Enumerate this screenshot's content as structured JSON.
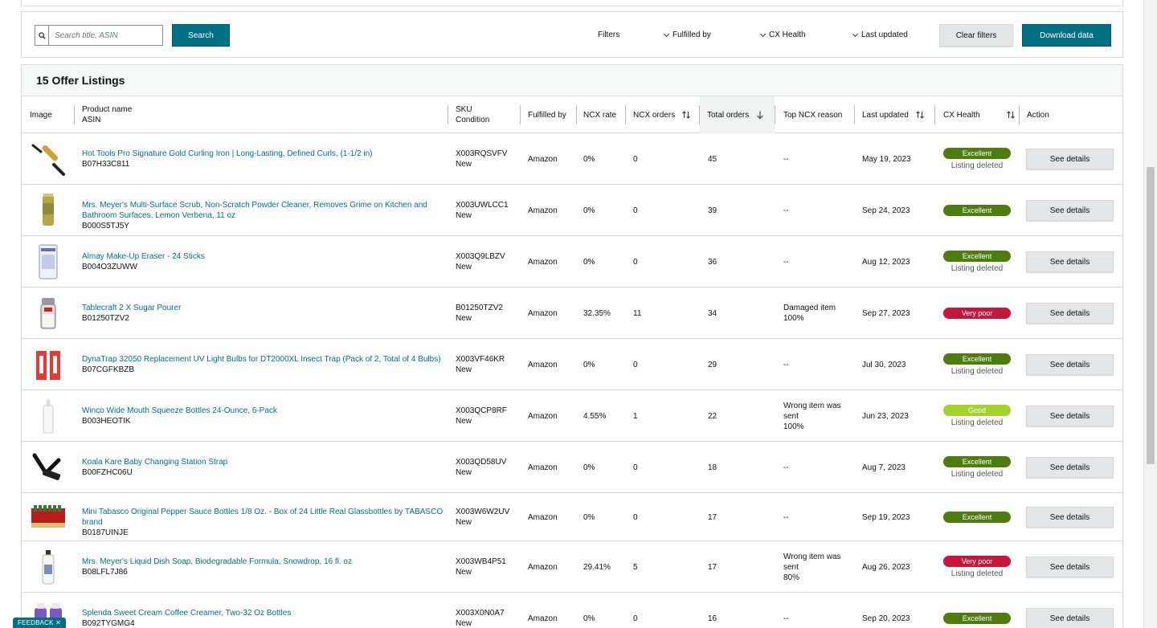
{
  "filters": {
    "search_placeholder": "Search title, ASIN",
    "search_label": "Search",
    "filters_label": "Filters",
    "fulfilled_by_label": "Fulfilled by",
    "cx_health_label": "CX Health",
    "last_updated_label": "Last updated",
    "clear_label": "Clear filters",
    "download_label": "Download data"
  },
  "listings": {
    "title": "15 Offer Listings",
    "columns": {
      "image": "Image",
      "product_name": "Product name",
      "asin": "ASIN",
      "sku": "SKU",
      "condition": "Condition",
      "fulfilled_by": "Fulfilled by",
      "ncx_rate": "NCX rate",
      "ncx_orders": "NCX orders",
      "total_orders": "Total orders",
      "top_ncx_reason": "Top NCX reason",
      "last_updated": "Last updated",
      "cx_health": "CX Health",
      "action": "Action"
    },
    "sorted_column": "total_orders",
    "rows": [
      {
        "name": "Hot Tools Pro Signature Gold Curling Iron | Long-Lasting, Defined Curls, (1-1/2 in)",
        "asin": "B07H33C811",
        "sku": "X003RQSVFV",
        "condition": "New",
        "fulfilled_by": "Amazon",
        "ncx_rate": "0%",
        "ncx_orders": "0",
        "total_orders": "45",
        "reason_1": "--",
        "reason_2": "",
        "reason_3": "",
        "last_updated": "May 19, 2023",
        "health": "Excellent",
        "health_color": "#4d7c0f",
        "note": "Listing deleted",
        "action": "See details",
        "thumb": "curling-iron-image"
      },
      {
        "name": "Mrs. Meyer's Multi-Surface Scrub, Non-Scratch Powder Cleaner, Removes Grime on Kitchen and Bathroom Surfaces, Lemon Verbena, 11 oz",
        "asin": "B000S5TJ5Y",
        "sku": "X003UWLCC1",
        "condition": "New",
        "fulfilled_by": "Amazon",
        "ncx_rate": "0%",
        "ncx_orders": "0",
        "total_orders": "39",
        "reason_1": "--",
        "reason_2": "",
        "reason_3": "",
        "last_updated": "Sep 24, 2023",
        "health": "Excellent",
        "health_color": "#4d7c0f",
        "note": "",
        "action": "See details",
        "thumb": "scrub-canister-image"
      },
      {
        "name": "Almay Make-Up Eraser - 24 Sticks",
        "asin": "B004O3ZUWW",
        "sku": "X003Q9LBZV",
        "condition": "New",
        "fulfilled_by": "Amazon",
        "ncx_rate": "0%",
        "ncx_orders": "0",
        "total_orders": "36",
        "reason_1": "--",
        "reason_2": "",
        "reason_3": "",
        "last_updated": "Aug 12, 2023",
        "health": "Excellent",
        "health_color": "#4d7c0f",
        "note": "Listing deleted",
        "action": "See details",
        "thumb": "makeup-eraser-image"
      },
      {
        "name": "Tablecraft 2 X Sugar Pourer",
        "asin": "B01250TZV2",
        "sku": "B01250TZV2",
        "condition": "New",
        "fulfilled_by": "Amazon",
        "ncx_rate": "32.35%",
        "ncx_orders": "11",
        "total_orders": "34",
        "reason_1": "Damaged item",
        "reason_2": "100%",
        "reason_3": "",
        "last_updated": "Sep 27, 2023",
        "health": "Very poor",
        "health_color": "#c7163c",
        "note": "",
        "action": "See details",
        "thumb": "sugar-pourer-image"
      },
      {
        "name": "DynaTrap 32050 Replacement UV Light Bulbs for DT2000XL Insect Trap (Pack of 2, Total of 4 Bulbs)",
        "asin": "B07CGFKBZB",
        "sku": "X003VF46KR",
        "condition": "New",
        "fulfilled_by": "Amazon",
        "ncx_rate": "0%",
        "ncx_orders": "0",
        "total_orders": "29",
        "reason_1": "--",
        "reason_2": "",
        "reason_3": "",
        "last_updated": "Jul 30, 2023",
        "health": "Excellent",
        "health_color": "#4d7c0f",
        "note": "Listing deleted",
        "action": "See details",
        "thumb": "uv-bulbs-image"
      },
      {
        "name": "Winco Wide Mouth Squeeze Bottles 24-Ounce, 6-Pack",
        "asin": "B003HEOTIK",
        "sku": "X003QCP8RF",
        "condition": "New",
        "fulfilled_by": "Amazon",
        "ncx_rate": "4.55%",
        "ncx_orders": "1",
        "total_orders": "22",
        "reason_1": "Wrong item was",
        "reason_2": "sent",
        "reason_3": "100%",
        "last_updated": "Jun 23, 2023",
        "health": "Good",
        "health_color": "#a4d12c",
        "note": "Listing deleted",
        "action": "See details",
        "thumb": "squeeze-bottle-image"
      },
      {
        "name": "Koala Kare Baby Changing Station Strap",
        "asin": "B00FZHC06U",
        "sku": "X003QD58UV",
        "condition": "New",
        "fulfilled_by": "Amazon",
        "ncx_rate": "0%",
        "ncx_orders": "0",
        "total_orders": "18",
        "reason_1": "--",
        "reason_2": "",
        "reason_3": "",
        "last_updated": "Aug 7, 2023",
        "health": "Excellent",
        "health_color": "#4d7c0f",
        "note": "Listing deleted",
        "action": "See details",
        "thumb": "strap-image"
      },
      {
        "name": "Mini Tabasco Original Pepper Sauce Bottles 1/8 Oz. - Box of 24 Little Real Glassbottles by TABASCO brand",
        "asin": "B0187UINJE",
        "sku": "X003W6W2UV",
        "condition": "New",
        "fulfilled_by": "Amazon",
        "ncx_rate": "0%",
        "ncx_orders": "0",
        "total_orders": "17",
        "reason_1": "--",
        "reason_2": "",
        "reason_3": "",
        "last_updated": "Sep 19, 2023",
        "health": "Excellent",
        "health_color": "#4d7c0f",
        "note": "",
        "action": "See details",
        "thumb": "tabasco-box-image"
      },
      {
        "name": "Mrs. Meyer's Liquid Dish Soap, Biodegradable Formula, Snowdrop, 16 fl. oz",
        "asin": "B08LFL7J86",
        "sku": "X003WB4P51",
        "condition": "New",
        "fulfilled_by": "Amazon",
        "ncx_rate": "29.41%",
        "ncx_orders": "5",
        "total_orders": "17",
        "reason_1": "Wrong item was",
        "reason_2": "sent",
        "reason_3": "80%",
        "last_updated": "Aug 26, 2023",
        "health": "Very poor",
        "health_color": "#c7163c",
        "note": "Listing deleted",
        "action": "See details",
        "thumb": "dish-soap-image"
      },
      {
        "name": "Splenda Sweet Cream Coffee Creamer, Two-32 Oz Bottles",
        "asin": "B092TYGMG4",
        "sku": "X003X0N0A7",
        "condition": "New",
        "fulfilled_by": "Amazon",
        "ncx_rate": "0%",
        "ncx_orders": "0",
        "total_orders": "16",
        "reason_1": "--",
        "reason_2": "",
        "reason_3": "",
        "last_updated": "Sep 20, 2023",
        "health": "Excellent",
        "health_color": "#4d7c0f",
        "note": "",
        "action": "See details",
        "thumb": "creamer-bottles-image"
      }
    ]
  },
  "feedback_label": "FEEDBACK ✕"
}
